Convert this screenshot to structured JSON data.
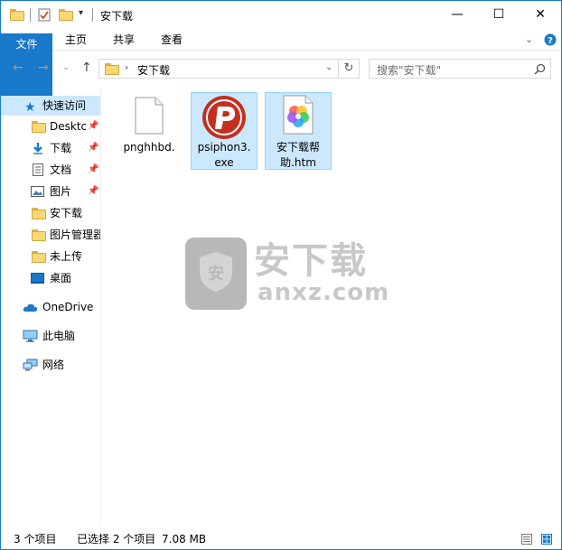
{
  "window": {
    "title": "安下载",
    "controls": {
      "minimize": "—",
      "maximize": "☐",
      "close": "✕"
    }
  },
  "ribbon": {
    "tabs": [
      {
        "label": "文件"
      },
      {
        "label": "主页"
      },
      {
        "label": "共享"
      },
      {
        "label": "查看"
      }
    ]
  },
  "address": {
    "path": "安下载",
    "search_placeholder": "搜索\"安下载\""
  },
  "nav": {
    "items": [
      {
        "label": "快速访问"
      },
      {
        "label": "Desktc"
      },
      {
        "label": "下载"
      },
      {
        "label": "文档"
      },
      {
        "label": "图片"
      },
      {
        "label": "安下载"
      },
      {
        "label": "图片管理器"
      },
      {
        "label": "未上传"
      },
      {
        "label": "桌面"
      },
      {
        "label": "OneDrive"
      },
      {
        "label": "此电脑"
      },
      {
        "label": "网络"
      }
    ]
  },
  "files": [
    {
      "name": "pnghhbd.",
      "icon": "blank-file-icon",
      "selected": false
    },
    {
      "name": "psiphon3.exe",
      "line1": "psiphon3.",
      "line2": "exe",
      "icon": "psiphon-app-icon",
      "selected": true
    },
    {
      "name": "安下载帮助.htm",
      "line1": "安下载帮",
      "line2": "助.htm",
      "icon": "htm-file-icon",
      "selected": true
    }
  ],
  "watermark": {
    "title": "安下载",
    "subtitle": "anxz.com"
  },
  "status": {
    "count": "3 个项目",
    "selection": "已选择 2 个项目",
    "size": "7.08 MB"
  },
  "colors": {
    "accent": "#1979ca",
    "selection": "#cce8ff"
  }
}
